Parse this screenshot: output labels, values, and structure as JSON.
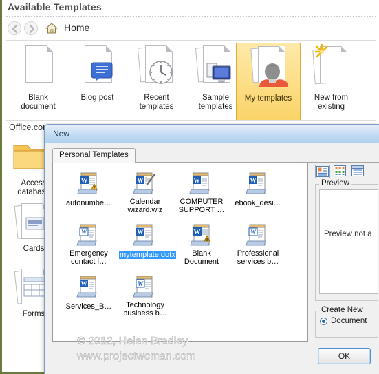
{
  "backstage": {
    "title": "Available Templates",
    "breadcrumb": "Home",
    "back_icon": "arrow-left-icon",
    "forward_icon": "arrow-right-icon",
    "home_icon": "home-icon",
    "section_label": "Office.com",
    "tiles": [
      {
        "label_line1": "Blank",
        "label_line2": "document",
        "icon": "blank-document-icon",
        "selected": false
      },
      {
        "label_line1": "Blog post",
        "label_line2": "",
        "icon": "blog-post-icon",
        "selected": false
      },
      {
        "label_line1": "Recent",
        "label_line2": "templates",
        "icon": "recent-templates-icon",
        "selected": false
      },
      {
        "label_line1": "Sample",
        "label_line2": "templates",
        "icon": "sample-templates-icon",
        "selected": false
      },
      {
        "label_line1": "My templates",
        "label_line2": "",
        "icon": "my-templates-icon",
        "selected": true
      },
      {
        "label_line1": "New from",
        "label_line2": "existing",
        "icon": "new-from-existing-icon",
        "selected": false
      }
    ],
    "categories": [
      {
        "label_line1": "Access",
        "label_line2": "database",
        "icon": "folder-icon"
      },
      {
        "label_line1": "Cards",
        "label_line2": "",
        "icon": "cards-icon"
      },
      {
        "label_line1": "Forms",
        "label_line2": "",
        "icon": "forms-icon"
      }
    ]
  },
  "dialog": {
    "title": "New",
    "tabs": [
      {
        "label": "Personal Templates",
        "active": true
      }
    ],
    "files": [
      {
        "name": "autonumbe…",
        "icon": "word-template-warning-icon",
        "selected": false
      },
      {
        "name": "Calendar wizard.wiz",
        "icon": "word-wizard-icon",
        "selected": false
      },
      {
        "name": "COMPUTER SUPPORT …",
        "icon": "word-document-icon",
        "selected": false
      },
      {
        "name": "ebook_desi…",
        "icon": "word-document-icon",
        "selected": false
      },
      {
        "name": "Emergency contact l…",
        "icon": "word-template-icon",
        "selected": false
      },
      {
        "name": "mytemplate.dotx",
        "icon": "word-template-icon",
        "selected": true
      },
      {
        "name": "Blank Document",
        "icon": "word-template-warning-icon",
        "selected": false
      },
      {
        "name": "Professional services b…",
        "icon": "word-template-icon",
        "selected": false
      },
      {
        "name": "Services_B…",
        "icon": "word-document-icon",
        "selected": false
      },
      {
        "name": "Technology business b…",
        "icon": "word-template-icon",
        "selected": false
      }
    ],
    "view_buttons": [
      {
        "icon": "large-icons-view-icon",
        "active": true
      },
      {
        "icon": "list-view-icon",
        "active": false
      },
      {
        "icon": "details-view-icon",
        "active": false
      }
    ],
    "preview": {
      "group_label": "Preview",
      "message": "Preview not a"
    },
    "create_new": {
      "group_label": "Create New",
      "options": [
        {
          "label": "Document",
          "selected": true
        }
      ]
    },
    "ok_label": "OK"
  },
  "watermark": {
    "line1": "© 2012, Helen Bradley",
    "line2": "www.projectwoman.com"
  },
  "colors": {
    "accent_green": "#6a7a3c",
    "selection_blue": "#3399ff",
    "tile_highlight": "#fbd469",
    "dialog_titlebar": "#c3dcf3"
  }
}
